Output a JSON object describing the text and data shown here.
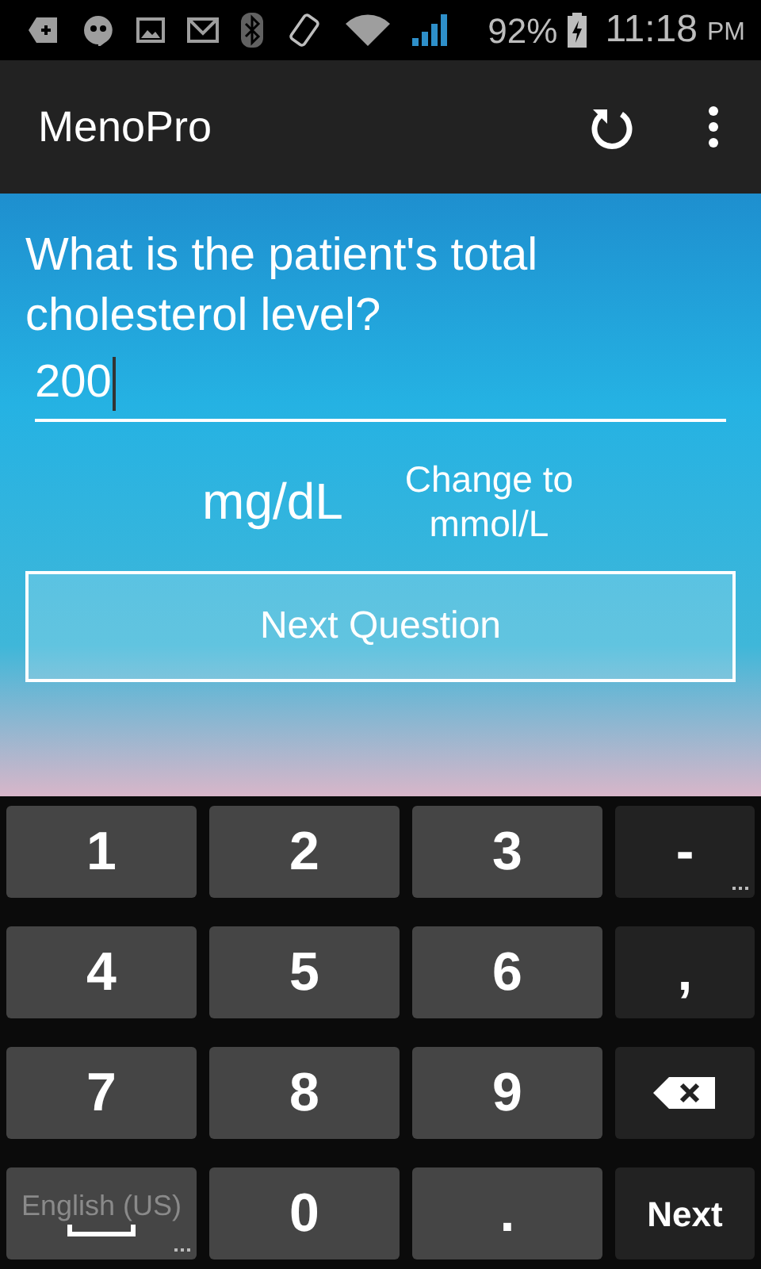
{
  "status_bar": {
    "battery": "92%",
    "time": "11:18",
    "time_suffix": "PM"
  },
  "app_bar": {
    "title": "MenoPro"
  },
  "question": {
    "text": "What is the patient's total cholesterol level?",
    "value": "200",
    "unit": "mg/dL",
    "change_unit": "Change to mmol/L",
    "next_button": "Next Question"
  },
  "keyboard": {
    "rows": [
      [
        {
          "label": "1",
          "kind": "digit",
          "more": false
        },
        {
          "label": "2",
          "kind": "digit",
          "more": false
        },
        {
          "label": "3",
          "kind": "digit",
          "more": false
        },
        {
          "label": "-",
          "kind": "symbol",
          "more": true
        }
      ],
      [
        {
          "label": "4",
          "kind": "digit",
          "more": false
        },
        {
          "label": "5",
          "kind": "digit",
          "more": false
        },
        {
          "label": "6",
          "kind": "digit",
          "more": false
        },
        {
          "label": ",",
          "kind": "symbol",
          "more": false
        }
      ],
      [
        {
          "label": "7",
          "kind": "digit",
          "more": false
        },
        {
          "label": "8",
          "kind": "digit",
          "more": false
        },
        {
          "label": "9",
          "kind": "digit",
          "more": false
        },
        {
          "kind": "delete",
          "more": false
        }
      ],
      [
        {
          "label": "English (US)",
          "kind": "language",
          "more": true
        },
        {
          "label": "0",
          "kind": "digit",
          "more": false
        },
        {
          "label": ".",
          "kind": "digit",
          "more": false
        },
        {
          "label": "Next",
          "kind": "action",
          "more": false
        }
      ]
    ]
  }
}
